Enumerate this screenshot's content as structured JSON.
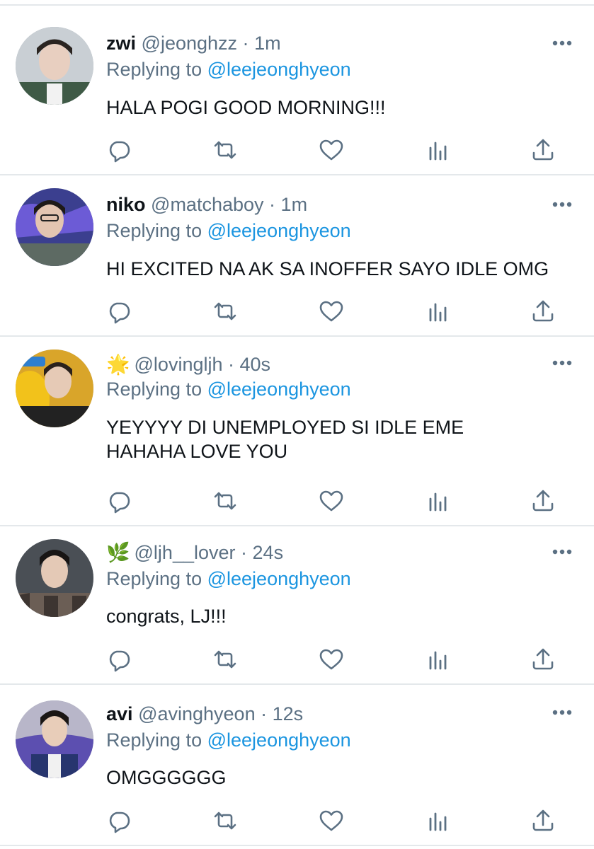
{
  "tweets": [
    {
      "display_name": "zwi",
      "handle": "@jeonghzz",
      "separator": "·",
      "time": "1m",
      "badge": "",
      "replying_prefix": "Replying to",
      "replying_to": "@leejeonghyeon",
      "text": "HALA POGI GOOD MORNING!!!"
    },
    {
      "display_name": "niko",
      "handle": "@matchaboy",
      "separator": "·",
      "time": "1m",
      "badge": "",
      "replying_prefix": "Replying to",
      "replying_to": "@leejeonghyeon",
      "text": "HI EXCITED NA AK SA INOFFER SAYO IDLE OMG"
    },
    {
      "display_name": "",
      "handle": "@lovingljh",
      "separator": "·",
      "time": "40s",
      "badge": "🌟",
      "replying_prefix": "Replying to",
      "replying_to": "@leejeonghyeon",
      "text": "YEYYYY DI UNEMPLOYED SI IDLE EME HAHAHA LOVE YOU"
    },
    {
      "display_name": "",
      "handle": "@ljh__lover",
      "separator": "·",
      "time": "24s",
      "badge": "🌿",
      "replying_prefix": "Replying to",
      "replying_to": "@leejeonghyeon",
      "text": "congrats, LJ!!!"
    },
    {
      "display_name": "avi",
      "handle": "@avinghyeon",
      "separator": "·",
      "time": "12s",
      "badge": "",
      "replying_prefix": "Replying to",
      "replying_to": "@leejeonghyeon",
      "text": "OMGGGGGG"
    }
  ],
  "icons": {
    "reply": "reply-icon",
    "retweet": "retweet-icon",
    "like": "like-icon",
    "analytics": "analytics-icon",
    "share": "share-icon",
    "more": "more-icon"
  },
  "colors": {
    "mention": "#1b95e0",
    "secondary_text": "#5b7083",
    "primary_text": "#0f1419",
    "divider": "#e4e8eb"
  }
}
